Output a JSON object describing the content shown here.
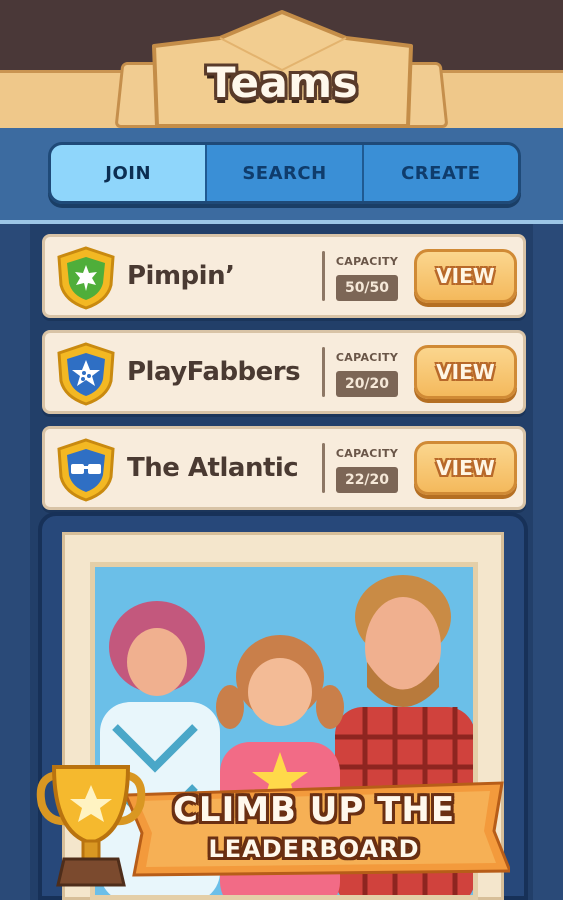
{
  "header": {
    "title": "Teams"
  },
  "tabs": [
    {
      "label": "JOIN",
      "active": true
    },
    {
      "label": "SEARCH",
      "active": false
    },
    {
      "label": "CREATE",
      "active": false
    }
  ],
  "teams": [
    {
      "name": "Pimpin’",
      "capacity_label": "CAPACITY",
      "capacity": "50/50",
      "button": "VIEW",
      "icon": "leaf-shield-icon",
      "shield_color": "#4fae3a"
    },
    {
      "name": "PlayFabbers",
      "capacity_label": "CAPACITY",
      "capacity": "20/20",
      "button": "VIEW",
      "icon": "star-shield-icon",
      "shield_color": "#2f6fc4"
    },
    {
      "name": "The Atlantic",
      "capacity_label": "CAPACITY",
      "capacity": "22/20",
      "button": "VIEW",
      "icon": "glasses-shield-icon",
      "shield_color": "#2f6fc4"
    }
  ],
  "promo": {
    "line1": "CLIMB UP THE",
    "line2": "LEADERBOARD",
    "icon": "trophy-icon"
  },
  "colors": {
    "accent_blue": "#3a8fd6",
    "active_tab": "#8fd6fb",
    "button_orange": "#f4b95c",
    "card_bg": "#f8ecdc"
  }
}
